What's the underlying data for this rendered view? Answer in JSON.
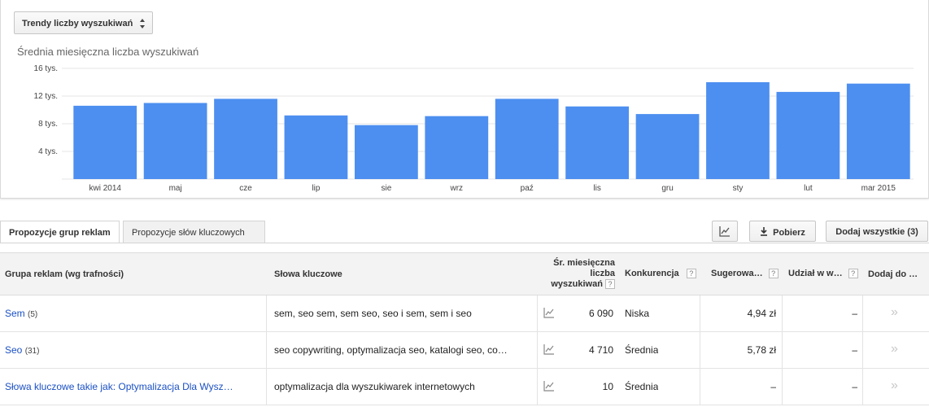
{
  "trend_select": {
    "label": "Trendy liczby wyszukiwań"
  },
  "chart_data": {
    "type": "bar",
    "title": "Średnia miesięczna liczba wyszukiwań",
    "categories": [
      "kwi 2014",
      "maj",
      "cze",
      "lip",
      "sie",
      "wrz",
      "paź",
      "lis",
      "gru",
      "sty",
      "lut",
      "mar 2015"
    ],
    "values": [
      10600,
      11000,
      11600,
      9200,
      7800,
      9100,
      11600,
      10500,
      9400,
      14000,
      12600,
      13800
    ],
    "yticks": [
      4000,
      8000,
      12000,
      16000
    ],
    "ytick_labels": [
      "4 tys.",
      "8 tys.",
      "12 tys.",
      "16 tys."
    ],
    "ylim": [
      0,
      16000
    ],
    "grid": true,
    "color": "#4d8ff0"
  },
  "tabs": [
    {
      "label": "Propozycje grup reklam",
      "active": true
    },
    {
      "label": "Propozycje słów kluczowych",
      "active": false
    }
  ],
  "toolbar": {
    "chart_icon": "line-chart-icon",
    "download_label": "Pobierz",
    "add_all_label": "Dodaj wszystkie (3)"
  },
  "table": {
    "headers": {
      "group": "Grupa reklam (wg trafności)",
      "keywords": "Słowa kluczowe",
      "avg_searches_1": "Śr. miesięczna",
      "avg_searches_2": "liczba",
      "avg_searches_3": "wyszukiwań",
      "competition": "Konkurencja",
      "suggested_bid": "Sugerowa…",
      "impression_share": "Udział w w…",
      "add_to": "Dodaj do …",
      "help": "?"
    },
    "rows": [
      {
        "group": "Sem",
        "count": "(5)",
        "keywords": "sem, seo sem, sem seo, seo i sem, sem i seo",
        "searches": "6 090",
        "competition": "Niska",
        "bid": "4,94 zł",
        "share": "–",
        "add": "»"
      },
      {
        "group": "Seo",
        "count": "(31)",
        "keywords": "seo copywriting, optymalizacja seo, katalogi seo, co…",
        "searches": "4 710",
        "competition": "Średnia",
        "bid": "5,78 zł",
        "share": "–",
        "add": "»"
      },
      {
        "group": "Słowa kluczowe takie jak: Optymalizacja Dla Wysz…",
        "count": "",
        "keywords": "optymalizacja dla wyszukiwarek internetowych",
        "searches": "10",
        "competition": "Średnia",
        "bid": "–",
        "share": "–",
        "add": "»"
      }
    ]
  }
}
